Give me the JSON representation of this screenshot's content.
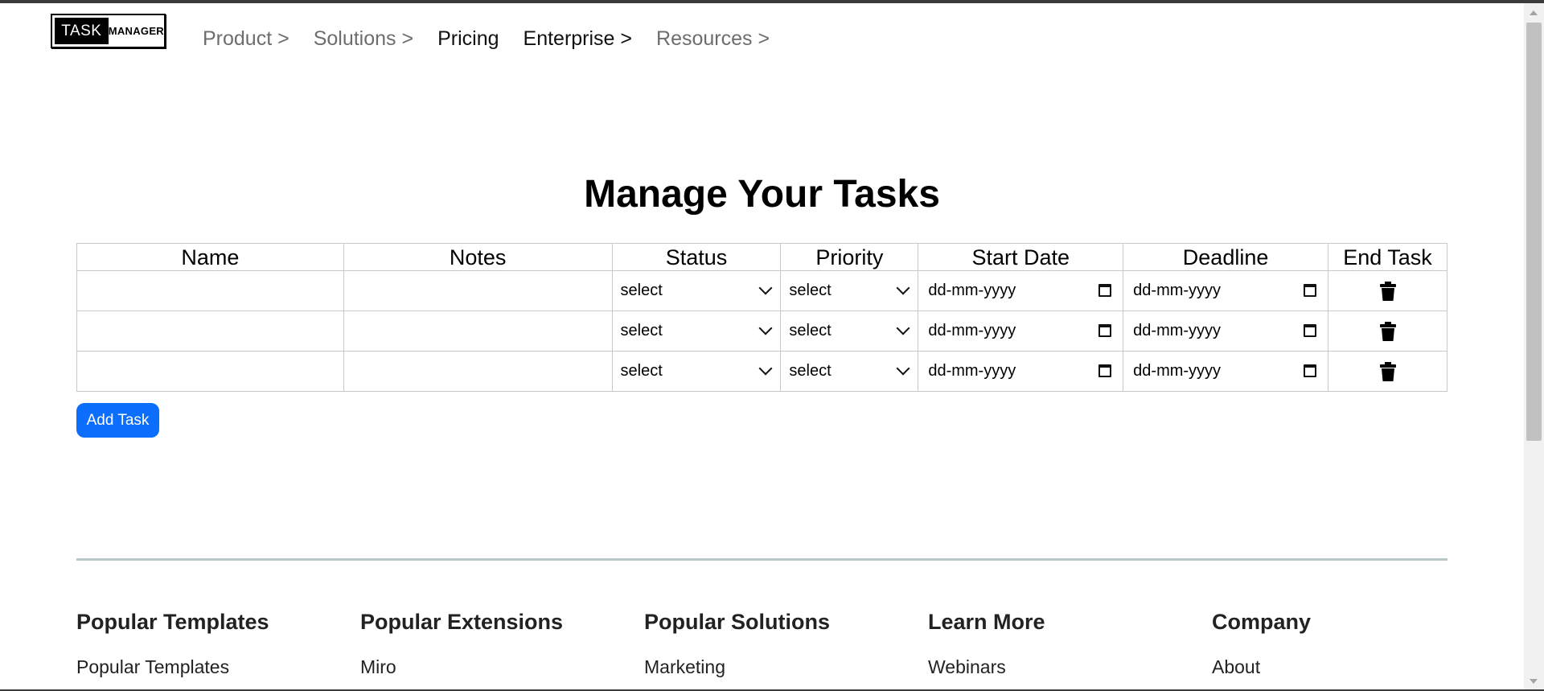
{
  "logo": {
    "task": "TASK",
    "manager": "MANAGER"
  },
  "nav": [
    {
      "label": "Product >"
    },
    {
      "label": "Solutions >"
    },
    {
      "label": "Pricing"
    },
    {
      "label": "Enterprise >"
    },
    {
      "label": "Resources >"
    }
  ],
  "page": {
    "title": "Manage Your Tasks"
  },
  "table": {
    "headers": [
      "Name",
      "Notes",
      "Status",
      "Priority",
      "Start Date",
      "Deadline",
      "End Task"
    ],
    "rows": [
      {
        "name": "",
        "notes": "",
        "status": "select",
        "priority": "select",
        "start": "dd-mm-yyyy",
        "deadline": "dd-mm-yyyy"
      },
      {
        "name": "",
        "notes": "",
        "status": "select",
        "priority": "select",
        "start": "dd-mm-yyyy",
        "deadline": "dd-mm-yyyy"
      },
      {
        "name": "",
        "notes": "",
        "status": "select",
        "priority": "select",
        "start": "dd-mm-yyyy",
        "deadline": "dd-mm-yyyy"
      }
    ],
    "end_icon": "trash-icon"
  },
  "add_button": {
    "label": "Add Task",
    "color": "#0b6efd"
  },
  "footer": [
    {
      "heading": "Popular Templates",
      "link": "Popular Templates"
    },
    {
      "heading": "Popular Extensions",
      "link": "Miro"
    },
    {
      "heading": "Popular Solutions",
      "link": "Marketing"
    },
    {
      "heading": "Learn More",
      "link": "Webinars"
    },
    {
      "heading": "Company",
      "link": "About"
    }
  ]
}
